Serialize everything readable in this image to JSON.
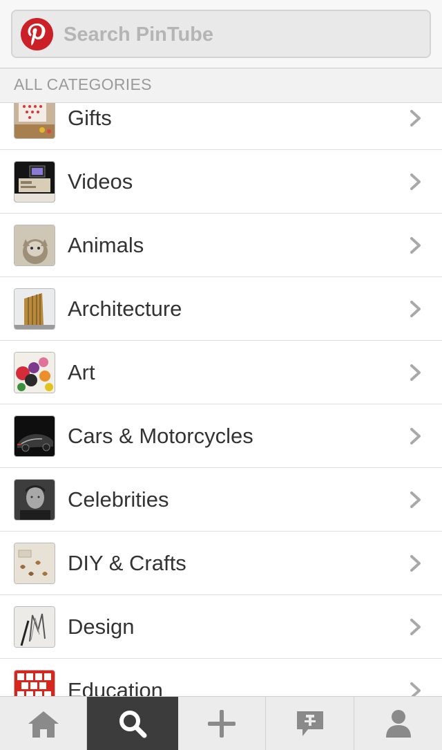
{
  "search": {
    "placeholder": "Search PinTube",
    "value": ""
  },
  "section_header": "ALL CATEGORIES",
  "categories": [
    {
      "label": "Gifts"
    },
    {
      "label": "Videos"
    },
    {
      "label": "Animals"
    },
    {
      "label": "Architecture"
    },
    {
      "label": "Art"
    },
    {
      "label": "Cars & Motorcycles"
    },
    {
      "label": "Celebrities"
    },
    {
      "label": "DIY & Crafts"
    },
    {
      "label": "Design"
    },
    {
      "label": "Education"
    }
  ],
  "tabs": [
    {
      "icon": "home-icon",
      "active": false
    },
    {
      "icon": "search-icon",
      "active": true
    },
    {
      "icon": "plus-icon",
      "active": false
    },
    {
      "icon": "news-icon",
      "active": false
    },
    {
      "icon": "profile-icon",
      "active": false
    }
  ],
  "colors": {
    "brand": "#cb2027",
    "tab_active": "#3c3c3c",
    "text": "#333333",
    "muted": "#9a9a9a"
  }
}
